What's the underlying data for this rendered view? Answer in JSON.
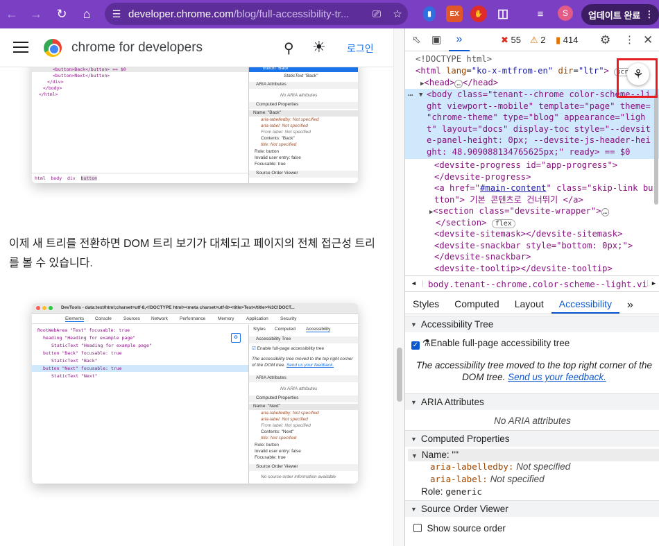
{
  "browser": {
    "url_host": "developer.chrome.com",
    "url_path": "/blog/full-accessibility-tr...",
    "profile_initial": "S",
    "update_label": "업데이트 완료",
    "ext_labels": [
      "EX"
    ]
  },
  "site": {
    "brand": "chrome for developers",
    "login_label": "로그인"
  },
  "article": {
    "paragraph": "이제 새 트리를 전환하면 DOM 트리 보기가 대체되고 페이지의 전체 접근성 트리를 볼 수 있습니다.",
    "shot1": {
      "code_lines": [
        "<button>Back</button> == $0",
        "<button>Next</button>",
        "</div>",
        "</body>",
        "</html>"
      ],
      "breadcrumb": [
        "html",
        "body",
        "div",
        "button"
      ],
      "tree_button": "button \"Back\"",
      "tree_static": "StaticText \"Back\"",
      "aria_header": "ARIA Attributes",
      "no_aria": "No ARIA attributes",
      "computed_header": "Computed Properties",
      "name_row": "Name: \"Back\"",
      "props": [
        "aria-labelledby: Not specified",
        "aria-label: Not specified",
        "From label: Not specified",
        "Contents: \"Back\"",
        "title: Not specified"
      ],
      "role": "Role: button",
      "invalid": "Invalid user entry: false",
      "focusable": "Focusable: true",
      "source_order": "Source Order Viewer"
    },
    "shot2": {
      "title": "DevTools - data:text/html;charset=utf-8,<!DOCTYPE html><meta charset=utf-8><title>Test</title>%3C!DOCT...",
      "tabs": [
        "Elements",
        "Console",
        "Sources",
        "Network",
        "Performance",
        "Memory",
        "Application",
        "Security"
      ],
      "tree": [
        "RootWebArea \"Test\" focusable: true",
        "heading \"Heading for example page\"",
        "StaticText \"Heading for example page\"",
        "button \"Back\" focusable: true",
        "StaticText \"Back\"",
        "button \"Next\" focusable: true",
        "StaticText \"Next\""
      ],
      "side_tabs": [
        "Styles",
        "Computed",
        "Accessibility"
      ],
      "acc_tree": "Accessibility Tree",
      "enable": "Enable full-page accessibility tree",
      "moved_note": "The accessibility tree moved to the top right corner of the DOM tree.",
      "feedback": "Send us your feedback.",
      "aria_header": "ARIA Attributes",
      "no_aria": "No ARIA attributes",
      "computed_header": "Computed Properties",
      "name_row": "Name: \"Next\"",
      "props": [
        "aria-labelledby: Not specified",
        "aria-label: Not specified",
        "From label: Not specified",
        "Contents: \"Next\"",
        "title: Not specified"
      ],
      "role": "Role: button",
      "invalid": "Invalid user entry: false",
      "focusable": "Focusable: true",
      "source_order": "Source Order Viewer",
      "no_source": "No source order information available"
    }
  },
  "devtools": {
    "errors": "55",
    "warnings": "2",
    "issues": "414",
    "crumb": "body.tenant--chrome.color-scheme--light.viewpor",
    "tabs": [
      "Styles",
      "Computed",
      "Layout",
      "Accessibility"
    ],
    "active_tab": "Accessibility",
    "acc_tree_header": "Accessibility Tree",
    "enable_label": "Enable full-page accessibility tree",
    "moved_note": "The accessibility tree moved to the top right corner of the",
    "moved_note2": "DOM tree.",
    "feedback": "Send us your feedback.",
    "aria_header": "ARIA Attributes",
    "no_aria": "No ARIA attributes",
    "computed_header": "Computed Properties",
    "name_label": "Name: \"\"",
    "labelledby_key": "aria-labelledby:",
    "labelledby_val": "Not specified",
    "label_key": "aria-label:",
    "label_val": "Not specified",
    "role_label": "Role:",
    "role_val": "generic",
    "source_header": "Source Order Viewer",
    "show_source": "Show source order",
    "dom": {
      "doctype": "<!DOCTYPE html>",
      "html_open": "<html",
      "html_lang_attr": "lang",
      "html_lang_val": "\"ko-x-mtfrom-en\"",
      "html_dir_attr": "dir",
      "html_dir_val": "\"ltr\"",
      "scroll_badge": "scr",
      "head": "<head>",
      "head_close": "</head>",
      "body_line1": "<body class=\"tenant--chrome color-scheme--li",
      "body_line2": "ght viewport--mobile\" template=\"page\" theme=",
      "body_line3": "\"chrome-theme\" type=\"blog\" appearance=\"ligh",
      "body_line4": "t\" layout=\"docs\" display-toc style=\"--devsit",
      "body_line5": "e-panel-height: 0px; --devsite-js-header-hei",
      "body_line6": "ght: 48.909088134765625px;\" ready> == $0",
      "l1": "<devsite-progress id=\"app-progress\">",
      "l2": "</devsite-progress>",
      "l3a": "<a href=\"",
      "l3b": "#main-content",
      "l3c": "\" class=\"skip-link bu",
      "l4": "tton\"> 기본 콘텐츠로 건너뛰기 </a>",
      "l5": "<section class=\"devsite-wrapper\">",
      "l6": "</section>",
      "flex_badge": "flex",
      "l7": "<devsite-sitemask></devsite-sitemask>",
      "l8": "<devsite-snackbar style=\"bottom: 0px;\">",
      "l9": "</devsite-snackbar>",
      "l10": "<devsite-tooltip></devsite-tooltip>"
    }
  }
}
